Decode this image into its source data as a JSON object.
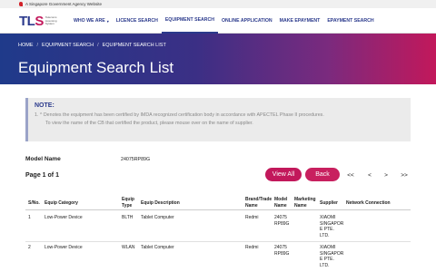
{
  "gov_bar": {
    "text": "A Singapore Government Agency Website"
  },
  "logo": {
    "mark_a": "TL",
    "mark_b": "S",
    "sub1": "Telecoms",
    "sub2": "Licensing",
    "sub3": "System"
  },
  "nav": {
    "items": [
      {
        "label": "WHO WE ARE"
      },
      {
        "label": "LICENCE SEARCH"
      },
      {
        "label": "EQUIPMENT SEARCH"
      },
      {
        "label": "ONLINE APPLICATION"
      },
      {
        "label": "MAKE EPAYMENT"
      },
      {
        "label": "EPAYMENT SEARCH"
      }
    ]
  },
  "breadcrumb": {
    "items": [
      "HOME",
      "EQUIPMENT SEARCH",
      "EQUIPMENT SEARCH LIST"
    ],
    "separator": "/"
  },
  "page_title": "Equipment Search List",
  "note": {
    "title": "NOTE:",
    "line1": "1. ^ Denotes the equipment has been certified by IMDA recognized certification body in accordance with APECTEL Phase II procedures.",
    "line2": "To view the name of the CB that certified the product, please mouse over on the name of supplier."
  },
  "model": {
    "label": "Model Name",
    "value": "24075RP89G"
  },
  "pagination": {
    "info": "Page 1 of 1",
    "first": "<<",
    "prev": "<",
    "next": ">",
    "last": ">>"
  },
  "buttons": {
    "view_all": "View All",
    "back": "Back"
  },
  "table": {
    "headers": {
      "sno": "S/No.",
      "category": "Equip Category",
      "type1": "Equip",
      "type2": "Type",
      "desc": "Equip Description",
      "brand1": "Brand/Trade",
      "brand2": "Name",
      "model1": "Model",
      "model2": "Name",
      "mkt1": "Marketing",
      "mkt2": "Name",
      "supplier": "Supplier",
      "network": "Network Connection"
    },
    "rows": [
      {
        "sno": "1",
        "category": "Low-Power Device",
        "type": "BLTH",
        "desc": "Tablet Computer",
        "brand": "Redmi",
        "model1": "24075",
        "model2": "RP89G",
        "supplier1": "XIAOMI",
        "supplier2": "SINGAPOR",
        "supplier3": "E PTE.",
        "supplier4": "LTD."
      },
      {
        "sno": "2",
        "category": "Low-Power Device",
        "type": "WLAN",
        "desc": "Tablet Computer",
        "brand": "Redmi",
        "model1": "24075",
        "model2": "RP89G",
        "supplier1": "XIAOMI",
        "supplier2": "SINGAPOR",
        "supplier3": "E PTE.",
        "supplier4": "LTD."
      }
    ]
  },
  "colors": {
    "brand_blue": "#2b3a8c",
    "brand_pink": "#c2185b"
  }
}
